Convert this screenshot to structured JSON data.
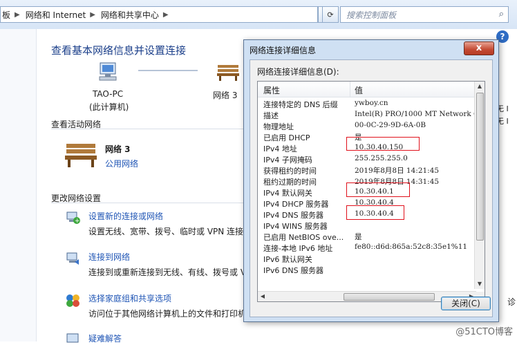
{
  "address": {
    "crumb0": "板",
    "crumb1": "网络和 Internet",
    "crumb2": "网络和共享中心",
    "refresh_icon": "refresh-icon",
    "dropdown_icon": "chevron-down-icon"
  },
  "search": {
    "placeholder": "搜索控制面板"
  },
  "main": {
    "title": "查看基本网络信息并设置连接",
    "computer_name": "TAO-PC",
    "computer_sub": "(此计算机)",
    "network_short": "网络 3",
    "active_section": "查看活动网络",
    "network_name": "网络  3",
    "network_type": "公用网络",
    "change_section": "更改网络设置",
    "tasks": [
      {
        "link": "设置新的连接或网络",
        "desc": "设置无线、宽带、拨号、临时或 VPN 连接"
      },
      {
        "link": "连接到网络",
        "desc": "连接到或重新连接到无线、有线、拨号或 V"
      },
      {
        "link": "选择家庭组和共享选项",
        "desc": "访问位于其他网络计算机上的文件和打印机"
      },
      {
        "link": "疑难解答",
        "desc": ""
      }
    ],
    "right_partial": [
      "无 I",
      "无 I",
      "诊"
    ]
  },
  "dialog": {
    "title": "网络连接详细信息",
    "label": "网络连接详细信息(D):",
    "col_property": "属性",
    "col_value": "值",
    "rows": [
      {
        "p": "连接特定的 DNS 后缀",
        "v": "ywboy.cn"
      },
      {
        "p": "描述",
        "v": "Intel(R) PRO/1000 MT Network C"
      },
      {
        "p": "物理地址",
        "v": "00-0C-29-9D-6A-0B"
      },
      {
        "p": "已启用 DHCP",
        "v": "是"
      },
      {
        "p": "IPv4 地址",
        "v": "10.30.40.150"
      },
      {
        "p": "IPv4 子网掩码",
        "v": "255.255.255.0"
      },
      {
        "p": "获得租约的时间",
        "v": "2019年8月8日 14:21:45"
      },
      {
        "p": "租约过期的时间",
        "v": "2019年8月8日 14:31:45"
      },
      {
        "p": "IPv4 默认网关",
        "v": "10.30.40.1"
      },
      {
        "p": "IPv4 DHCP 服务器",
        "v": "10.30.40.4"
      },
      {
        "p": "IPv4 DNS 服务器",
        "v": "10.30.40.4"
      },
      {
        "p": "IPv4 WINS 服务器",
        "v": ""
      },
      {
        "p": "已启用 NetBIOS ove...",
        "v": "是"
      },
      {
        "p": "连接-本地 IPv6 地址",
        "v": "fe80::d6d:865a:52c8:35e1%11"
      },
      {
        "p": "IPv6 默认网关",
        "v": ""
      },
      {
        "p": "IPv6 DNS 服务器",
        "v": ""
      }
    ],
    "close_button": "关闭(C)",
    "close_x": "x"
  },
  "watermark": "@51CTO博客"
}
